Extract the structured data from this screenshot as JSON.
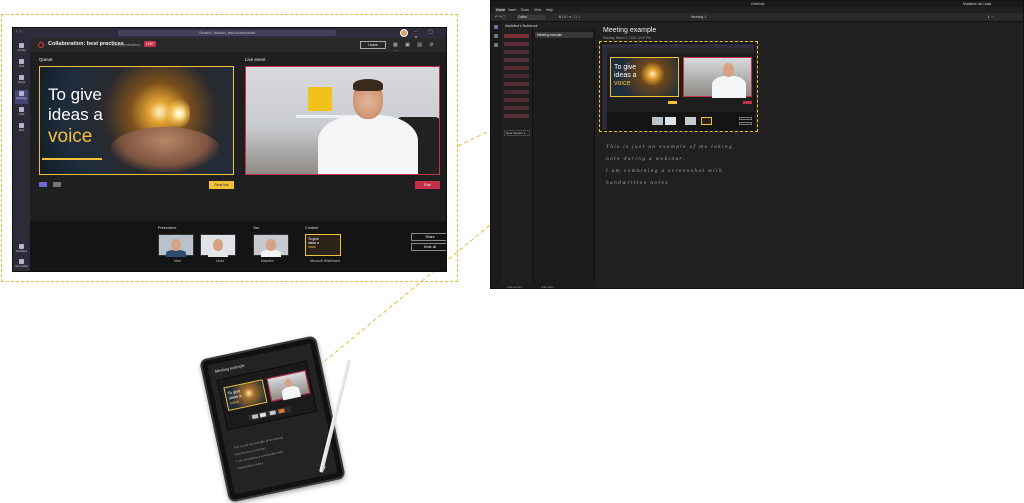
{
  "teams": {
    "search_placeholder": "Search, launch, and commands",
    "meeting_title": "Collaboration: best practices",
    "meeting_time": "23:51 (minutes)",
    "live_badge": "LIVE",
    "leave_button": "Leave",
    "rail": [
      "Activity",
      "Chat",
      "Teams",
      "Meetings",
      "Calls",
      "Files",
      "..."
    ],
    "rail_bottom": [
      "Feedback",
      "Get mobile"
    ],
    "queue_label": "Queue",
    "live_event_label": "Live event",
    "queue_slide_lines": [
      "To give",
      "ideas a",
      "voice"
    ],
    "send_live_button": "Send live",
    "end_button": "End",
    "tray": {
      "presenters_label": "Presenters",
      "you_label": "You",
      "content_label": "Content",
      "presenters": [
        "Mark",
        "Linda"
      ],
      "you_name": "Madeline",
      "content_name": "Microsoft Whiteboard",
      "content_slide_lines": [
        "To give",
        "ideas a",
        "voice"
      ],
      "share_button": "Share",
      "mute_all_button": "Mute all"
    }
  },
  "onenote": {
    "app_title": "OneNote",
    "user": "Madeline da Costa",
    "tabs": [
      "Home",
      "Insert",
      "Draw",
      "View",
      "Help"
    ],
    "font_name": "Calibri",
    "heading_style": "Heading 1",
    "notebook_name": "Madeline's Notebook",
    "page_list_item": "Meeting example",
    "add_section": "New Section 1",
    "footer_add_section": "Add section",
    "footer_add_page": "Add page",
    "page_title": "Meeting example",
    "page_date": "Monday, March 2, 2020     12:00 PM",
    "ink_lines": [
      "This is just an example of me taking",
      "note during a webinar.",
      "I am combining a screenshot with",
      "handwritten notes"
    ]
  },
  "colors": {
    "callout_dash": "#e8b93c",
    "teams_accent": "#464775",
    "live_red": "#c4314b",
    "slide_yellow": "#f3c03a",
    "onenote_purple": "#7b6fb2"
  }
}
